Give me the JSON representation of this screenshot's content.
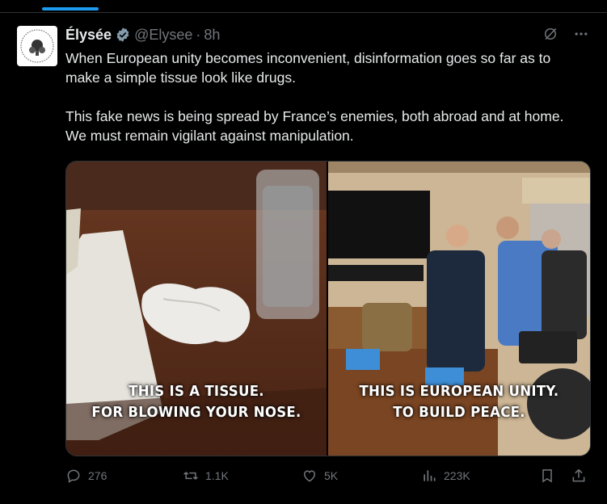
{
  "tweet": {
    "author_name": "Élysée",
    "handle": "@Elysee",
    "separator": "·",
    "time": "8h",
    "text_paragraphs": [
      "When European unity becomes inconvenient, disinformation goes so far as to make a simple tissue look like drugs.",
      "This fake news is being spread by France’s enemies, both abroad and at home. We must remain vigilant against manipulation."
    ],
    "media": {
      "left_caption": [
        "THIS IS A TISSUE.",
        "FOR BLOWING YOUR NOSE."
      ],
      "right_caption": [
        "THIS IS EUROPEAN UNITY.",
        "TO BUILD PEACE."
      ]
    },
    "stats": {
      "replies": "276",
      "reposts": "1.1K",
      "likes": "5K",
      "views": "223K"
    },
    "icons": {
      "verified": "verified-badge-icon",
      "grok": "grok-icon",
      "more": "more-icon",
      "reply": "reply-icon",
      "repost": "repost-icon",
      "like": "like-icon",
      "views": "views-icon",
      "bookmark": "bookmark-icon",
      "share": "share-icon"
    },
    "colors": {
      "accent": "#1d9bf0",
      "muted": "#71767b",
      "text": "#e7e9ea",
      "background": "#000000"
    }
  }
}
